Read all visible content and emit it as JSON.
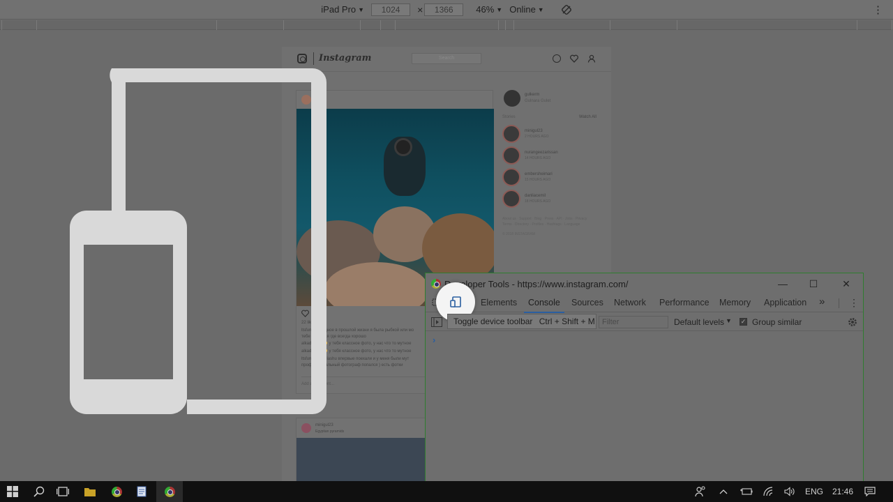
{
  "device_toolbar": {
    "device": "iPad Pro",
    "width": "1024",
    "times": "×",
    "height": "1366",
    "zoom": "46%",
    "throttling": "Online",
    "caret": "▼",
    "more": "⋮"
  },
  "instagram": {
    "wordmark": "Instagram",
    "search_placeholder": "Search",
    "post1_user": "ltsfun",
    "likes": "22 likes",
    "caption_lines": [
      "ltsfun Подводное в прошлой жизни я была рыбкой или мо",
      "тебе нравится где всегда хорошо",
      "alkadiashu 🙂 у тебя классное фото, у нас что то мутное",
      "alkadiashu 🙂 у тебя классное фото, у нас что то мутное",
      "ltsfun @alkadiashu впервые поехали и у меня были мут",
      "профессиональный фотограф попался ) есть фотки"
    ],
    "add_comment": "Add a comment...",
    "post2_user": "minigul23",
    "post2_location": "Egyptian pyramids",
    "me_user": "gulkerm",
    "me_name": "Gulnara Gulet",
    "stories_label": "Stories",
    "watch_all": "Watch All",
    "stories": [
      {
        "name": "minigul23",
        "time": "2 HOURS AGO"
      },
      {
        "name": "nurangeezarissan",
        "time": "14 HOURS AGO"
      },
      {
        "name": "embersheimari",
        "time": "15 HOURS AGO"
      },
      {
        "name": "danliacemil",
        "time": "18 HOURS AGO"
      }
    ],
    "footer_links": "About us · Support · Blog · Press · API · Jobs · Privacy",
    "footer_links2": "Terms · Directory · Profiles · Hashtags · Language",
    "copyright": "© 2018 INSTAGRAM"
  },
  "devtools": {
    "title": "Developer Tools - https://www.instagram.com/",
    "minimize": "—",
    "maximize": "☐",
    "close": "✕",
    "tabs": [
      "Elements",
      "Console",
      "Sources",
      "Network",
      "Performance",
      "Memory",
      "Application"
    ],
    "active_tab": "Console",
    "overflow": "»",
    "menu": "⋮",
    "filter_placeholder": "Filter",
    "levels": "Default levels",
    "levels_caret": "▼",
    "group_similar": "Group similar",
    "prompt": "›",
    "tooltip": "Toggle device toolbar",
    "tooltip_shortcut": "Ctrl + Shift + M"
  },
  "taskbar": {
    "language": "ENG",
    "time": "21:46"
  },
  "colors": {
    "active_tab_underline": "#2a5ea0",
    "devtools_border": "#2e7d2e"
  }
}
